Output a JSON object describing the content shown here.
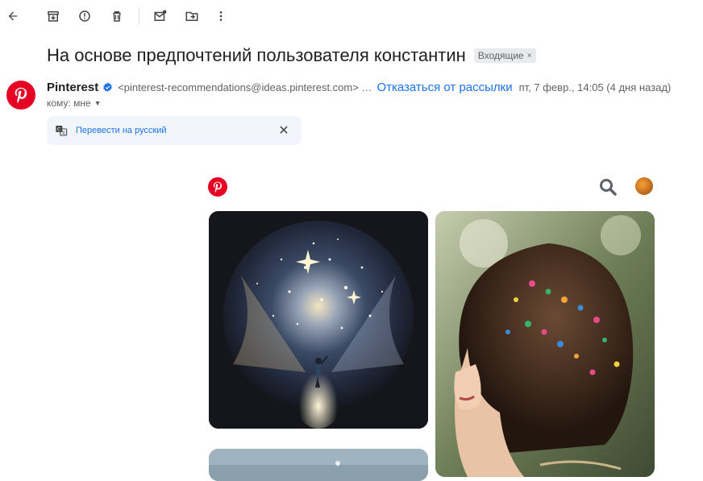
{
  "toolbar": {
    "buttons": [
      "back-icon",
      "archive-icon",
      "report-spam-icon",
      "delete-icon",
      "mark-unread-icon",
      "move-to-icon",
      "more-icon"
    ]
  },
  "email": {
    "subject": "На основе предпочтений пользователя константин",
    "label": "Входящие",
    "label_close": "×",
    "sender_name": "Pinterest",
    "sender_email": "<pinterest-recommendations@ideas.pinterest.com> …",
    "unsubscribe": "Отказаться от рассылки",
    "date": "пт, 7 февр., 14:05 (4 дня назад)",
    "to": "кому: мне",
    "translate_link": "Перевести на русский"
  },
  "colors": {
    "pinterest_red": "#e60023",
    "link_blue": "#1a73e8",
    "verified_blue": "#1a73e8"
  },
  "body": {
    "icons": [
      "pinterest-logo-icon",
      "search-icon",
      "user-avatar"
    ],
    "pins": [
      "cosmic-galaxy-artwork",
      "girl-with-beaded-hair",
      "partial-pin"
    ]
  }
}
